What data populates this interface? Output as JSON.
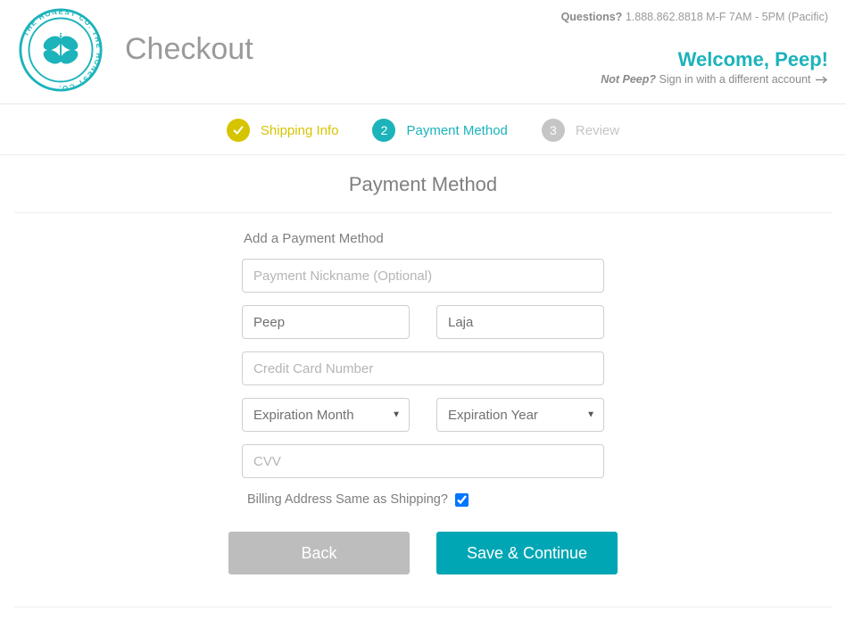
{
  "header": {
    "page_title": "Checkout",
    "questions_label": "Questions?",
    "questions_info": "1.888.862.8818 M-F 7AM - 5PM (Pacific)",
    "welcome": "Welcome, Peep!",
    "not_user_prefix": "Not Peep?",
    "not_user_link": "Sign in with a different account"
  },
  "steps": {
    "s1_label": "Shipping Info",
    "s2_num": "2",
    "s2_label": "Payment Method",
    "s3_num": "3",
    "s3_label": "Review"
  },
  "section": {
    "title": "Payment Method",
    "heading": "Add a Payment Method"
  },
  "form": {
    "nickname_placeholder": "Payment Nickname (Optional)",
    "first_name": "Peep",
    "last_name": "Laja",
    "card_placeholder": "Credit Card Number",
    "exp_month_label": "Expiration Month",
    "exp_year_label": "Expiration Year",
    "cvv_placeholder": "CVV",
    "billing_label": "Billing Address Same as Shipping?",
    "billing_checked": true
  },
  "buttons": {
    "back": "Back",
    "continue": "Save & Continue"
  }
}
